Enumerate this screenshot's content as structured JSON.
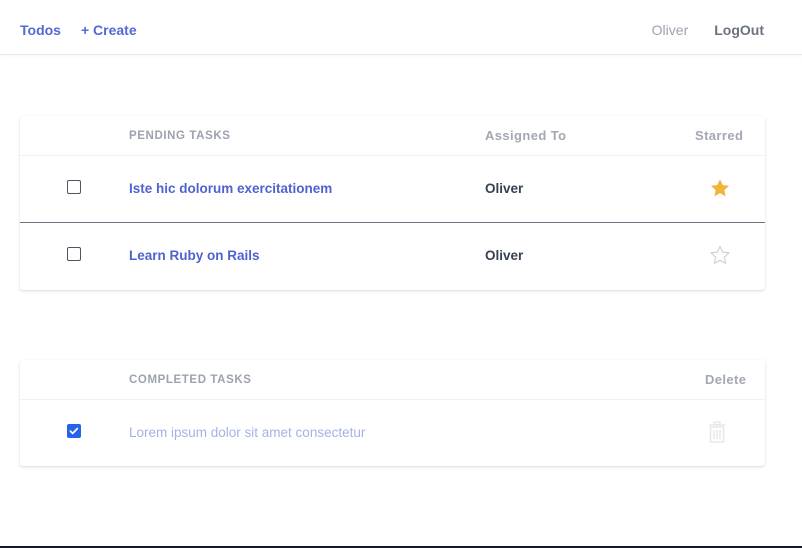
{
  "nav": {
    "todos": "Todos",
    "create": "+ Create",
    "user": "Oliver",
    "logout": "LogOut"
  },
  "pending": {
    "headers": {
      "title": "PENDING TASKS",
      "assigned": "Assigned To",
      "starred": "Starred"
    },
    "rows": [
      {
        "title": "Iste hic dolorum exercitationem",
        "assignee": "Oliver",
        "checked": false,
        "starred": true
      },
      {
        "title": "Learn Ruby on Rails",
        "assignee": "Oliver",
        "checked": false,
        "starred": false
      }
    ]
  },
  "completed": {
    "headers": {
      "title": "COMPLETED TASKS",
      "delete": "Delete"
    },
    "rows": [
      {
        "title": "Lorem ipsum dolor sit amet consectetur",
        "checked": true
      }
    ]
  },
  "colors": {
    "accent": "#4f63cf",
    "star_filled": "#f0b43a",
    "star_empty": "#d1d5db",
    "checkbox_checked": "#2563eb"
  }
}
